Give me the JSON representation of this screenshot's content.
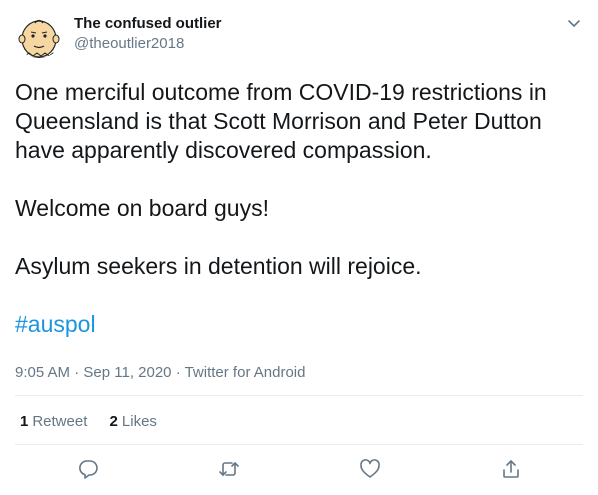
{
  "author": {
    "name": "The confused outlier",
    "handle": "@theoutlier2018",
    "avatar_icon": "cartoon-face-avatar"
  },
  "tweet": {
    "paragraph_1": "One merciful outcome from COVID-19 restrictions in Queensland is that Scott Morrison and Peter Dutton have apparently discovered compassion.",
    "paragraph_2": "Welcome on board guys!",
    "paragraph_3": "Asylum seekers in detention will rejoice.",
    "hashtag": "#auspol"
  },
  "meta": {
    "time": "9:05 AM",
    "separator_1": " · ",
    "date": "Sep 11, 2020",
    "separator_2": " · ",
    "source": "Twitter for Android"
  },
  "stats": {
    "retweets_count": "1",
    "retweets_label": "Retweet",
    "likes_count": "2",
    "likes_label": "Likes"
  },
  "actions": {
    "reply_icon": "reply-icon",
    "retweet_icon": "retweet-icon",
    "like_icon": "heart-icon",
    "share_icon": "share-icon",
    "menu_icon": "chevron-down-icon"
  },
  "colors": {
    "text": "#14171a",
    "secondary": "#657786",
    "link": "#1b95e0",
    "divider": "#e6ecf0"
  }
}
